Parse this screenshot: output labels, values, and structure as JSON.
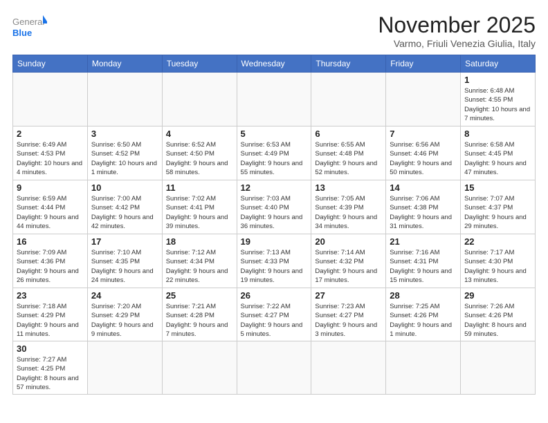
{
  "header": {
    "logo_general": "General",
    "logo_blue": "Blue",
    "month_title": "November 2025",
    "location": "Varmo, Friuli Venezia Giulia, Italy"
  },
  "weekdays": [
    "Sunday",
    "Monday",
    "Tuesday",
    "Wednesday",
    "Thursday",
    "Friday",
    "Saturday"
  ],
  "days": [
    {
      "num": null,
      "info": ""
    },
    {
      "num": null,
      "info": ""
    },
    {
      "num": null,
      "info": ""
    },
    {
      "num": null,
      "info": ""
    },
    {
      "num": null,
      "info": ""
    },
    {
      "num": null,
      "info": ""
    },
    {
      "num": "1",
      "info": "Sunrise: 6:48 AM\nSunset: 4:55 PM\nDaylight: 10 hours and 7 minutes."
    },
    {
      "num": "2",
      "info": "Sunrise: 6:49 AM\nSunset: 4:53 PM\nDaylight: 10 hours and 4 minutes."
    },
    {
      "num": "3",
      "info": "Sunrise: 6:50 AM\nSunset: 4:52 PM\nDaylight: 10 hours and 1 minute."
    },
    {
      "num": "4",
      "info": "Sunrise: 6:52 AM\nSunset: 4:50 PM\nDaylight: 9 hours and 58 minutes."
    },
    {
      "num": "5",
      "info": "Sunrise: 6:53 AM\nSunset: 4:49 PM\nDaylight: 9 hours and 55 minutes."
    },
    {
      "num": "6",
      "info": "Sunrise: 6:55 AM\nSunset: 4:48 PM\nDaylight: 9 hours and 52 minutes."
    },
    {
      "num": "7",
      "info": "Sunrise: 6:56 AM\nSunset: 4:46 PM\nDaylight: 9 hours and 50 minutes."
    },
    {
      "num": "8",
      "info": "Sunrise: 6:58 AM\nSunset: 4:45 PM\nDaylight: 9 hours and 47 minutes."
    },
    {
      "num": "9",
      "info": "Sunrise: 6:59 AM\nSunset: 4:44 PM\nDaylight: 9 hours and 44 minutes."
    },
    {
      "num": "10",
      "info": "Sunrise: 7:00 AM\nSunset: 4:42 PM\nDaylight: 9 hours and 42 minutes."
    },
    {
      "num": "11",
      "info": "Sunrise: 7:02 AM\nSunset: 4:41 PM\nDaylight: 9 hours and 39 minutes."
    },
    {
      "num": "12",
      "info": "Sunrise: 7:03 AM\nSunset: 4:40 PM\nDaylight: 9 hours and 36 minutes."
    },
    {
      "num": "13",
      "info": "Sunrise: 7:05 AM\nSunset: 4:39 PM\nDaylight: 9 hours and 34 minutes."
    },
    {
      "num": "14",
      "info": "Sunrise: 7:06 AM\nSunset: 4:38 PM\nDaylight: 9 hours and 31 minutes."
    },
    {
      "num": "15",
      "info": "Sunrise: 7:07 AM\nSunset: 4:37 PM\nDaylight: 9 hours and 29 minutes."
    },
    {
      "num": "16",
      "info": "Sunrise: 7:09 AM\nSunset: 4:36 PM\nDaylight: 9 hours and 26 minutes."
    },
    {
      "num": "17",
      "info": "Sunrise: 7:10 AM\nSunset: 4:35 PM\nDaylight: 9 hours and 24 minutes."
    },
    {
      "num": "18",
      "info": "Sunrise: 7:12 AM\nSunset: 4:34 PM\nDaylight: 9 hours and 22 minutes."
    },
    {
      "num": "19",
      "info": "Sunrise: 7:13 AM\nSunset: 4:33 PM\nDaylight: 9 hours and 19 minutes."
    },
    {
      "num": "20",
      "info": "Sunrise: 7:14 AM\nSunset: 4:32 PM\nDaylight: 9 hours and 17 minutes."
    },
    {
      "num": "21",
      "info": "Sunrise: 7:16 AM\nSunset: 4:31 PM\nDaylight: 9 hours and 15 minutes."
    },
    {
      "num": "22",
      "info": "Sunrise: 7:17 AM\nSunset: 4:30 PM\nDaylight: 9 hours and 13 minutes."
    },
    {
      "num": "23",
      "info": "Sunrise: 7:18 AM\nSunset: 4:29 PM\nDaylight: 9 hours and 11 minutes."
    },
    {
      "num": "24",
      "info": "Sunrise: 7:20 AM\nSunset: 4:29 PM\nDaylight: 9 hours and 9 minutes."
    },
    {
      "num": "25",
      "info": "Sunrise: 7:21 AM\nSunset: 4:28 PM\nDaylight: 9 hours and 7 minutes."
    },
    {
      "num": "26",
      "info": "Sunrise: 7:22 AM\nSunset: 4:27 PM\nDaylight: 9 hours and 5 minutes."
    },
    {
      "num": "27",
      "info": "Sunrise: 7:23 AM\nSunset: 4:27 PM\nDaylight: 9 hours and 3 minutes."
    },
    {
      "num": "28",
      "info": "Sunrise: 7:25 AM\nSunset: 4:26 PM\nDaylight: 9 hours and 1 minute."
    },
    {
      "num": "29",
      "info": "Sunrise: 7:26 AM\nSunset: 4:26 PM\nDaylight: 8 hours and 59 minutes."
    },
    {
      "num": "30",
      "info": "Sunrise: 7:27 AM\nSunset: 4:25 PM\nDaylight: 8 hours and 57 minutes."
    }
  ]
}
